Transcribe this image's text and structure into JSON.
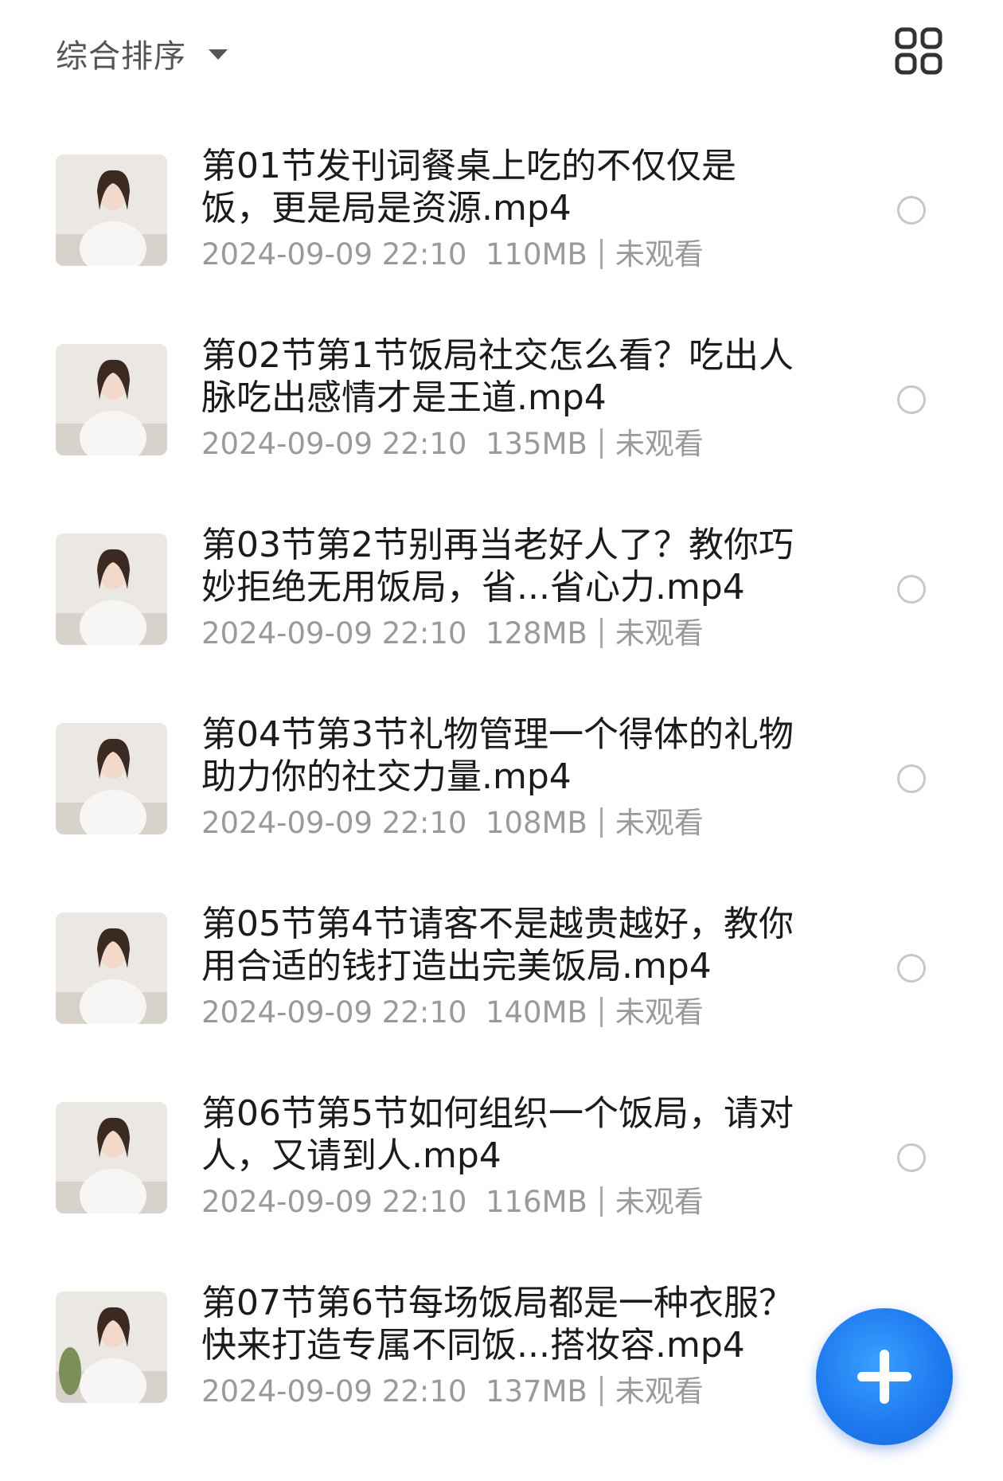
{
  "header": {
    "sort_label": "综合排序",
    "sort_caret_icon": "caret-down-icon",
    "view_toggle_icon": "grid-view-icon"
  },
  "files": [
    {
      "title": "第01节发刊词餐桌上吃的不仅仅是饭，更是局是资源.mp4",
      "date": "2024-09-09 22:10",
      "size": "110MB",
      "status": "未观看"
    },
    {
      "title": "第02节第1节饭局社交怎么看？吃出人脉吃出感情才是王道.mp4",
      "date": "2024-09-09 22:10",
      "size": "135MB",
      "status": "未观看"
    },
    {
      "title": "第03节第2节别再当老好人了？教你巧妙拒绝无用饭局，省...省心力.mp4",
      "date": "2024-09-09 22:10",
      "size": "128MB",
      "status": "未观看"
    },
    {
      "title": "第04节第3节礼物管理一个得体的礼物助力你的社交力量.mp4",
      "date": "2024-09-09 22:10",
      "size": "108MB",
      "status": "未观看"
    },
    {
      "title": "第05节第4节请客不是越贵越好，教你用合适的钱打造出完美饭局.mp4",
      "date": "2024-09-09 22:10",
      "size": "140MB",
      "status": "未观看"
    },
    {
      "title": "第06节第5节如何组织一个饭局，请对人，又请到人.mp4",
      "date": "2024-09-09 22:10",
      "size": "116MB",
      "status": "未观看"
    },
    {
      "title": "第07节第6节每场饭局都是一种衣服？快来打造专属不同饭...搭妆容.mp4",
      "date": "2024-09-09 22:10",
      "size": "137MB",
      "status": "未观看"
    }
  ],
  "fab": {
    "icon": "plus-icon"
  },
  "colors": {
    "accent": "#1f7bf0",
    "meta_text": "#9a9a9a",
    "title_text": "#1b1b1b"
  }
}
